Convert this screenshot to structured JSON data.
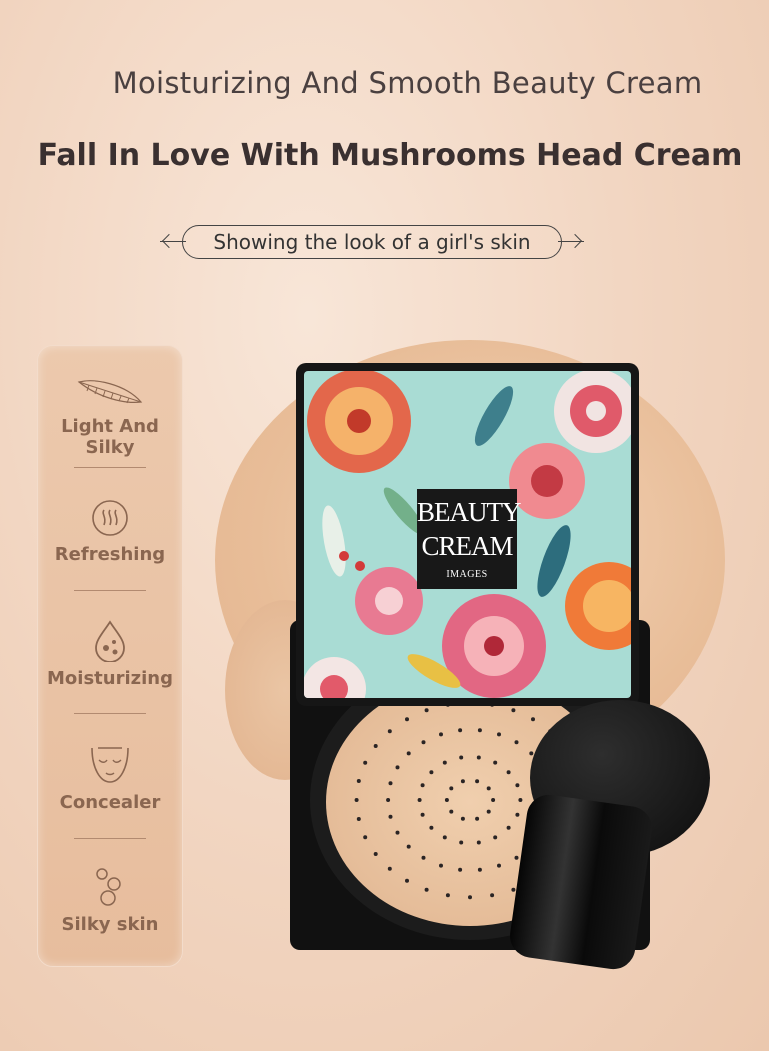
{
  "header": {
    "subtitle": "Moisturizing And Smooth Beauty Cream",
    "title": "Fall In Love With Mushrooms Head Cream",
    "tagline": "Showing the look of a girl's skin"
  },
  "features": [
    {
      "label": "Light And Silky",
      "icon": "feather-icon"
    },
    {
      "label": "Refreshing",
      "icon": "steam-circle-icon"
    },
    {
      "label": "Moisturizing",
      "icon": "water-drop-icon"
    },
    {
      "label": "Concealer",
      "icon": "face-icon"
    },
    {
      "label": "Silky skin",
      "icon": "bubbles-icon"
    }
  ],
  "product": {
    "brand_line1": "BEAUTY",
    "brand_line2": "CREAM",
    "brand_line3": "IMAGES"
  },
  "colors": {
    "background": "#f1d4bf",
    "panel": "#e9c2a4",
    "feature_text": "#8a6650",
    "case": "#161616",
    "lid_pattern": "#a9dcd4",
    "cream": "#e9c4a2"
  }
}
